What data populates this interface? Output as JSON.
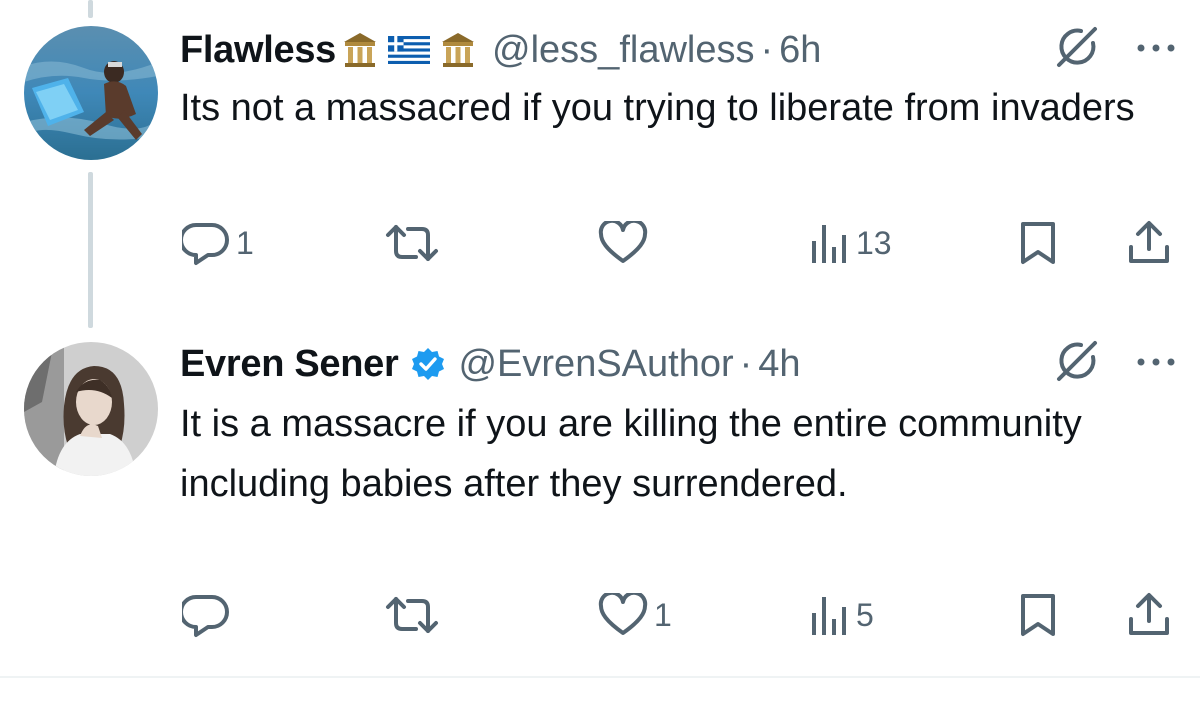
{
  "tweets": [
    {
      "display_name": "Flawless",
      "handle": "@less_flawless",
      "separator": "·",
      "time": "6h",
      "text": "Its not a massacred if you trying to liberate from invaders",
      "badges": [
        "classical-building-emoji",
        "greece-flag-emoji",
        "classical-building-emoji"
      ],
      "verified": false,
      "metrics": {
        "replies": "1",
        "reposts": "",
        "likes": "",
        "views": "13"
      }
    },
    {
      "display_name": "Evren Sener",
      "handle": "@EvrenSAuthor",
      "separator": "·",
      "time": "4h",
      "text": "It is a massacre if you are killing the entire community including babies after they surrendered.",
      "badges": [],
      "verified": true,
      "metrics": {
        "replies": "",
        "reposts": "",
        "likes": "1",
        "views": "5"
      }
    }
  ],
  "icons": {
    "reply": "reply-bubble-icon",
    "repost": "repost-arrows-icon",
    "like": "heart-icon",
    "views": "analytics-bars-icon",
    "bookmark": "bookmark-icon",
    "share": "share-upload-icon",
    "grok": "grok-icon",
    "more": "more-dots-icon",
    "verified": "verified-badge-icon"
  },
  "colors": {
    "text_primary": "#0f1419",
    "text_secondary": "#536471",
    "verified_blue": "#1d9bf0",
    "thread_line": "#cfd9de",
    "divider": "#eff3f4"
  }
}
